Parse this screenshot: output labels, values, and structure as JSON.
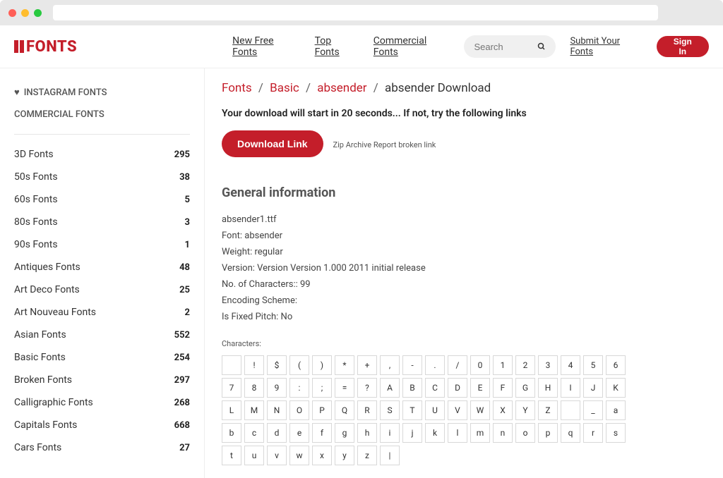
{
  "header": {
    "logo_text": "FONTS",
    "nav": [
      "New Free Fonts",
      "Top Fonts",
      "Commercial Fonts"
    ],
    "search_placeholder": "Search",
    "submit_link": "Submit Your Fonts",
    "signin": "Sign In"
  },
  "sidebar": {
    "top_links": [
      {
        "label": "INSTAGRAM FONTS",
        "icon": "heart"
      },
      {
        "label": "COMMERCIAL FONTS"
      }
    ],
    "categories": [
      {
        "name": "3D Fonts",
        "count": "295"
      },
      {
        "name": "50s Fonts",
        "count": "38"
      },
      {
        "name": "60s Fonts",
        "count": "5"
      },
      {
        "name": "80s Fonts",
        "count": "3"
      },
      {
        "name": "90s Fonts",
        "count": "1"
      },
      {
        "name": "Antiques Fonts",
        "count": "48"
      },
      {
        "name": "Art Deco Fonts",
        "count": "25"
      },
      {
        "name": "Art Nouveau Fonts",
        "count": "2"
      },
      {
        "name": "Asian Fonts",
        "count": "552"
      },
      {
        "name": "Basic Fonts",
        "count": "254"
      },
      {
        "name": "Broken Fonts",
        "count": "297"
      },
      {
        "name": "Calligraphic Fonts",
        "count": "268"
      },
      {
        "name": "Capitals Fonts",
        "count": "668"
      },
      {
        "name": "Cars Fonts",
        "count": "27"
      }
    ]
  },
  "breadcrumb": {
    "items": [
      "Fonts",
      "Basic",
      "absender"
    ],
    "current": "absender Download"
  },
  "download": {
    "status": "Your download will start in 20 seconds... If not, try the following links",
    "button": "Download Link",
    "archive": "Zip Archive",
    "report": "Report broken link"
  },
  "info": {
    "section_title": "General information",
    "filename": "absender1.ttf",
    "lines": [
      "Font: absender",
      "Weight: regular",
      "Version: Version Version 1.000 2011 initial release",
      "No. of Characters:: 99",
      "Encoding Scheme:",
      "Is Fixed Pitch: No"
    ],
    "chars_label": "Characters:",
    "characters": [
      " ",
      "!",
      "$",
      "(",
      ")",
      "*",
      "+",
      ",",
      "-",
      ".",
      "/",
      "0",
      "1",
      "2",
      "3",
      "4",
      "5",
      "6",
      "7",
      "8",
      "9",
      ":",
      ";",
      "=",
      "?",
      "A",
      "B",
      "C",
      "D",
      "E",
      "F",
      "G",
      "H",
      "I",
      "J",
      "K",
      "L",
      "M",
      "N",
      "O",
      "P",
      "Q",
      "R",
      "S",
      "T",
      "U",
      "V",
      "W",
      "X",
      "Y",
      "Z",
      " ",
      "_",
      "a",
      "b",
      "c",
      "d",
      "e",
      "f",
      "g",
      "h",
      "i",
      "j",
      "k",
      "l",
      "m",
      "n",
      "o",
      "p",
      "q",
      "r",
      "s",
      "t",
      "u",
      "v",
      "w",
      "x",
      "y",
      "z",
      "|"
    ]
  }
}
